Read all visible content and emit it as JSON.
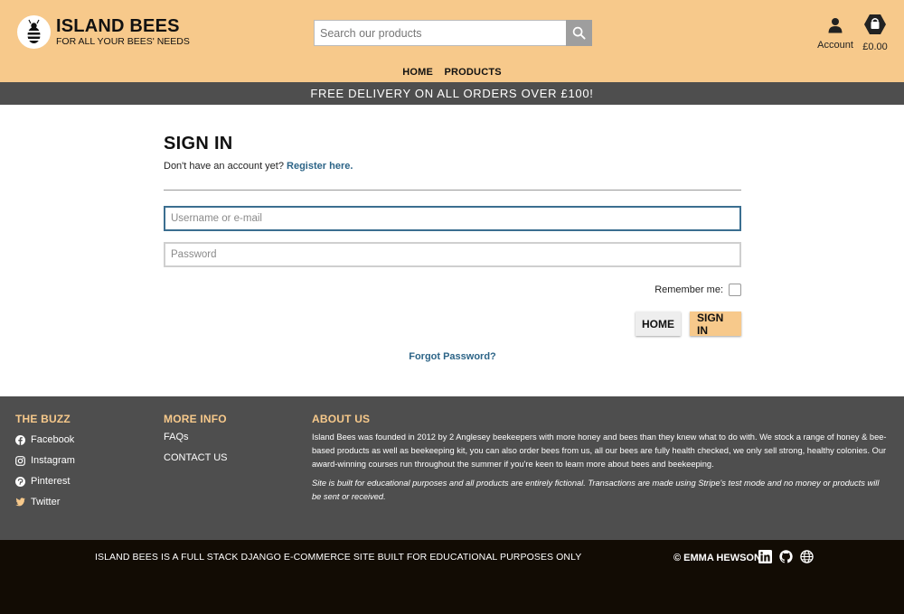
{
  "header": {
    "brand_title": "ISLAND BEES",
    "brand_subtitle": "FOR ALL YOUR BEES' NEEDS",
    "search_placeholder": "Search our products",
    "account_label": "Account",
    "bag_total": "£0.00",
    "nav": [
      "HOME",
      "PRODUCTS"
    ]
  },
  "promo": "FREE DELIVERY ON ALL ORDERS OVER £100!",
  "signin": {
    "title": "SIGN IN",
    "register_prompt": "Don't have an account yet?",
    "register_link": "Register here.",
    "username_placeholder": "Username or e-mail",
    "password_placeholder": "Password",
    "remember_label": "Remember me:",
    "remember_checked": false,
    "home_button": "HOME",
    "signin_button": "SIGN IN",
    "forgot_link": "Forgot Password?"
  },
  "footer": {
    "buzz_title": "THE BUZZ",
    "social": [
      {
        "label": "Facebook",
        "icon": "facebook-icon"
      },
      {
        "label": "Instagram",
        "icon": "instagram-icon"
      },
      {
        "label": "Pinterest",
        "icon": "pinterest-icon"
      },
      {
        "label": "Twitter",
        "icon": "twitter-icon"
      }
    ],
    "more_title": "MORE INFO",
    "more_links": [
      "FAQs",
      "CONTACT US"
    ],
    "about_title": "ABOUT US",
    "about_text": "Island Bees was founded in 2012 by 2 Anglesey beekeepers with more honey and bees than they knew what to do with. We stock a range of honey & bee-based products as well as beekeeping kit, you can also order bees from us, all our bees are fully health checked, we only sell strong, healthy colonies. Our award-winning courses run throughout the summer if you're keen to learn more about bees and beekeeping.",
    "disclaimer": "Site is built for educational purposes and all products are entirely fictional. Transactions are made using Stripe's test mode and no money or products will be sent or received."
  },
  "bottom": {
    "built_text": "ISLAND BEES IS A FULL STACK DJANGO E-COMMERCE SITE BUILT FOR EDUCATIONAL PURPOSES ONLY",
    "copyright": "© EMMA HEWSON",
    "icons": [
      "linkedin-icon",
      "github-icon",
      "globe-icon"
    ]
  },
  "colors": {
    "brand_yellow": "#f7c98b",
    "dark_grey": "#4e4e4e",
    "link_blue": "#2c6487",
    "footer_black": "#120c04"
  }
}
